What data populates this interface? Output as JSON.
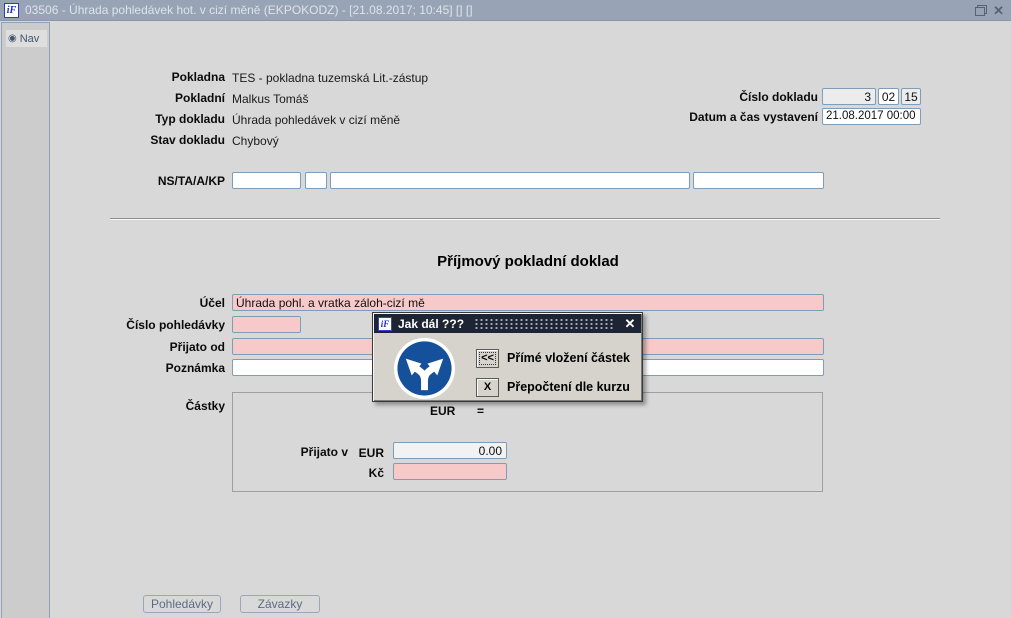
{
  "window": {
    "logo_text": "iF",
    "title": "03506 - Úhrada pohledávek hot. v cizí měně (EKPOKODZ) - [21.08.2017; 10:45] [] []"
  },
  "icons": {
    "nav_glyph": "◉",
    "window_close_glyph": "✕",
    "dialog_close_glyph": "✕"
  },
  "sidebar": {
    "nav_label": "Nav"
  },
  "header": {
    "rows": [
      {
        "label": "Pokladna",
        "value": "TES - pokladna tuzemská Lit.-zástup"
      },
      {
        "label": "Pokladní",
        "value": "Malkus Tomáš"
      },
      {
        "label": "Typ dokladu",
        "value": "Úhrada pohledávek v cizí měně"
      },
      {
        "label": "Stav dokladu",
        "value": "Chybový"
      }
    ],
    "doc_number": {
      "label": "Číslo dokladu",
      "part1": "3",
      "part2": "02",
      "part3": "15"
    },
    "issue": {
      "label": "Datum a čas vystavení",
      "value": "21.08.2017 00:00"
    },
    "ns_label": "NS/TA/A/KP"
  },
  "form": {
    "heading": "Příjmový pokladní doklad",
    "ucel": {
      "label": "Účel",
      "value": "Úhrada pohl. a vratka záloh-cizí mě"
    },
    "cislo_pohledavky": {
      "label": "Číslo pohledávky"
    },
    "prijato_od": {
      "label": "Přijato od"
    },
    "poznamka": {
      "label": "Poznámka"
    },
    "castky": {
      "label": "Částky",
      "currency": "EUR",
      "equals": "=",
      "prijato_v": "Přijato v",
      "eur_label": "EUR",
      "eur_value": "0.00",
      "kc_label": "Kč"
    }
  },
  "dialog": {
    "logo_text": "iF",
    "title": "Jak dál ???",
    "buttons": [
      {
        "key": "<<",
        "label": "Přímé vložení částek"
      },
      {
        "key": "X",
        "label": "Přepočtení dle kurzu"
      }
    ]
  },
  "footer": {
    "buttons": [
      {
        "label": "Pohledávky"
      },
      {
        "label": "Závazky"
      }
    ]
  },
  "colors": {
    "titlebar": "#98a4b5",
    "field_pink": "#f8c9c9",
    "dialog_titlebar": "#1d2433",
    "sign_blue": "#15519b",
    "field_border": "#7f9db9"
  }
}
